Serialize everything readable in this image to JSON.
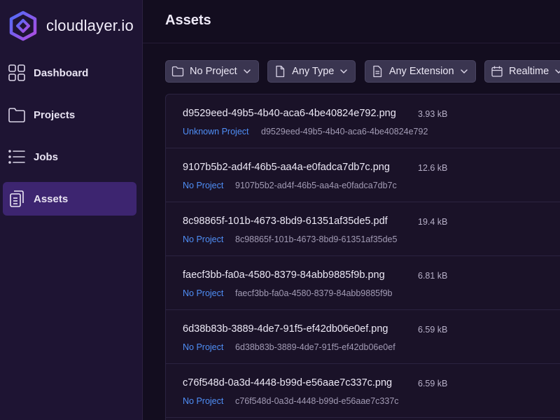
{
  "brand": {
    "name": "cloudlayer.io"
  },
  "sidebar": {
    "items": [
      {
        "label": "Dashboard",
        "icon": "dashboard-grid-icon"
      },
      {
        "label": "Projects",
        "icon": "folder-icon"
      },
      {
        "label": "Jobs",
        "icon": "list-icon"
      },
      {
        "label": "Assets",
        "icon": "documents-icon",
        "active": true
      }
    ]
  },
  "header": {
    "title": "Assets"
  },
  "filters": [
    {
      "label": "No Project",
      "icon": "folder-icon"
    },
    {
      "label": "Any Type",
      "icon": "file-icon"
    },
    {
      "label": "Any Extension",
      "icon": "file-text-icon"
    },
    {
      "label": "Realtime",
      "icon": "calendar-icon"
    }
  ],
  "assets": [
    {
      "name": "d9529eed-49b5-4b40-aca6-4be40824e792.png",
      "size": "3.93 kB",
      "project": "Unknown Project",
      "id": "d9529eed-49b5-4b40-aca6-4be40824e792"
    },
    {
      "name": "9107b5b2-ad4f-46b5-aa4a-e0fadca7db7c.png",
      "size": "12.6 kB",
      "project": "No Project",
      "id": "9107b5b2-ad4f-46b5-aa4a-e0fadca7db7c"
    },
    {
      "name": "8c98865f-101b-4673-8bd9-61351af35de5.pdf",
      "size": "19.4 kB",
      "project": "No Project",
      "id": "8c98865f-101b-4673-8bd9-61351af35de5"
    },
    {
      "name": "faecf3bb-fa0a-4580-8379-84abb9885f9b.png",
      "size": "6.81 kB",
      "project": "No Project",
      "id": "faecf3bb-fa0a-4580-8379-84abb9885f9b"
    },
    {
      "name": "6d38b83b-3889-4de7-91f5-ef42db06e0ef.png",
      "size": "6.59 kB",
      "project": "No Project",
      "id": "6d38b83b-3889-4de7-91f5-ef42db06e0ef"
    },
    {
      "name": "c76f548d-0a3d-4448-b99d-e56aae7c337c.png",
      "size": "6.59 kB",
      "project": "No Project",
      "id": "c76f548d-0a3d-4448-b99d-e56aae7c337c"
    }
  ],
  "colors": {
    "accent": "#3d2570",
    "link": "#4f8ff7",
    "sidebar_bg": "#1e1433",
    "page_bg": "#130d1f"
  }
}
